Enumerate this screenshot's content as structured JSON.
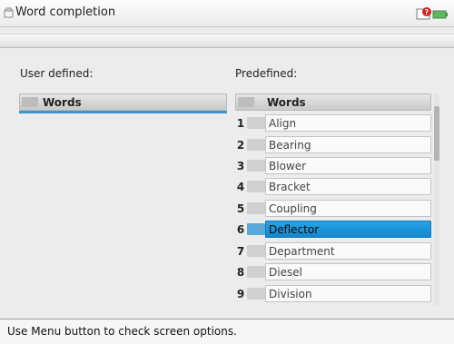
{
  "window": {
    "title": "Word completion",
    "title_icon": "document-icon",
    "status_icons": [
      "error-status-icon",
      "battery-icon"
    ]
  },
  "user_defined": {
    "label": "User defined:",
    "column_header": "Words",
    "items": []
  },
  "predefined": {
    "label": "Predefined:",
    "column_header": "Words",
    "items": [
      {
        "num": "1",
        "word": "Align"
      },
      {
        "num": "2",
        "word": "Bearing"
      },
      {
        "num": "3",
        "word": "Blower"
      },
      {
        "num": "4",
        "word": "Bracket"
      },
      {
        "num": "5",
        "word": "Coupling"
      },
      {
        "num": "6",
        "word": "Deflector"
      },
      {
        "num": "7",
        "word": "Department"
      },
      {
        "num": "8",
        "word": "Diesel"
      },
      {
        "num": "9",
        "word": "Division"
      }
    ],
    "selected_index": 5
  },
  "status_bar": {
    "text": "Use Menu button to check screen options."
  },
  "colors": {
    "selection": "#1b94d8",
    "user_list_underline": "#3f95cf"
  }
}
